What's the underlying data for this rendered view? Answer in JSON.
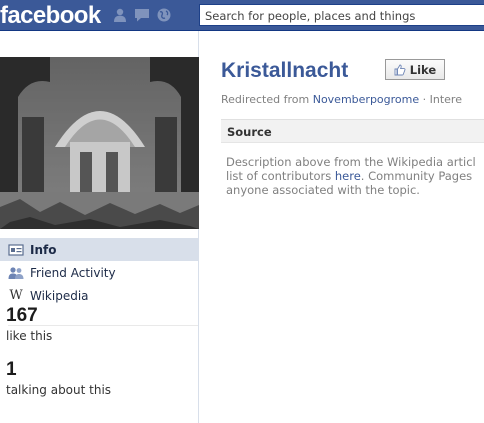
{
  "header": {
    "logo": "facebook",
    "search_placeholder": "Search for people, places and things",
    "jewel_color": "#7f93bc"
  },
  "sidebar": {
    "nav": [
      {
        "label": "Info",
        "icon": "info-card-icon"
      },
      {
        "label": "Friend Activity",
        "icon": "friends-icon"
      },
      {
        "label": "Wikipedia",
        "icon": "wikipedia-w-icon"
      }
    ],
    "stats": [
      {
        "number": "167",
        "label": "like this"
      },
      {
        "number": "1",
        "label": "talking about this"
      }
    ]
  },
  "page": {
    "title": "Kristallnacht",
    "like_label": "Like",
    "redirect_prefix": "Redirected from ",
    "redirect_link": "Novemberpogrome",
    "redirect_suffix": " · Intere",
    "source_title": "Source",
    "desc_line1": "Description above from the Wikipedia articl",
    "desc_line2_a": "list of contributors ",
    "desc_line2_link": "here",
    "desc_line2_b": ". Community Pages",
    "desc_line3": "anyone associated with the topic."
  },
  "colors": {
    "brand": "#3b5998",
    "link": "#3b5998",
    "nav_selected": "#d8dfea"
  }
}
